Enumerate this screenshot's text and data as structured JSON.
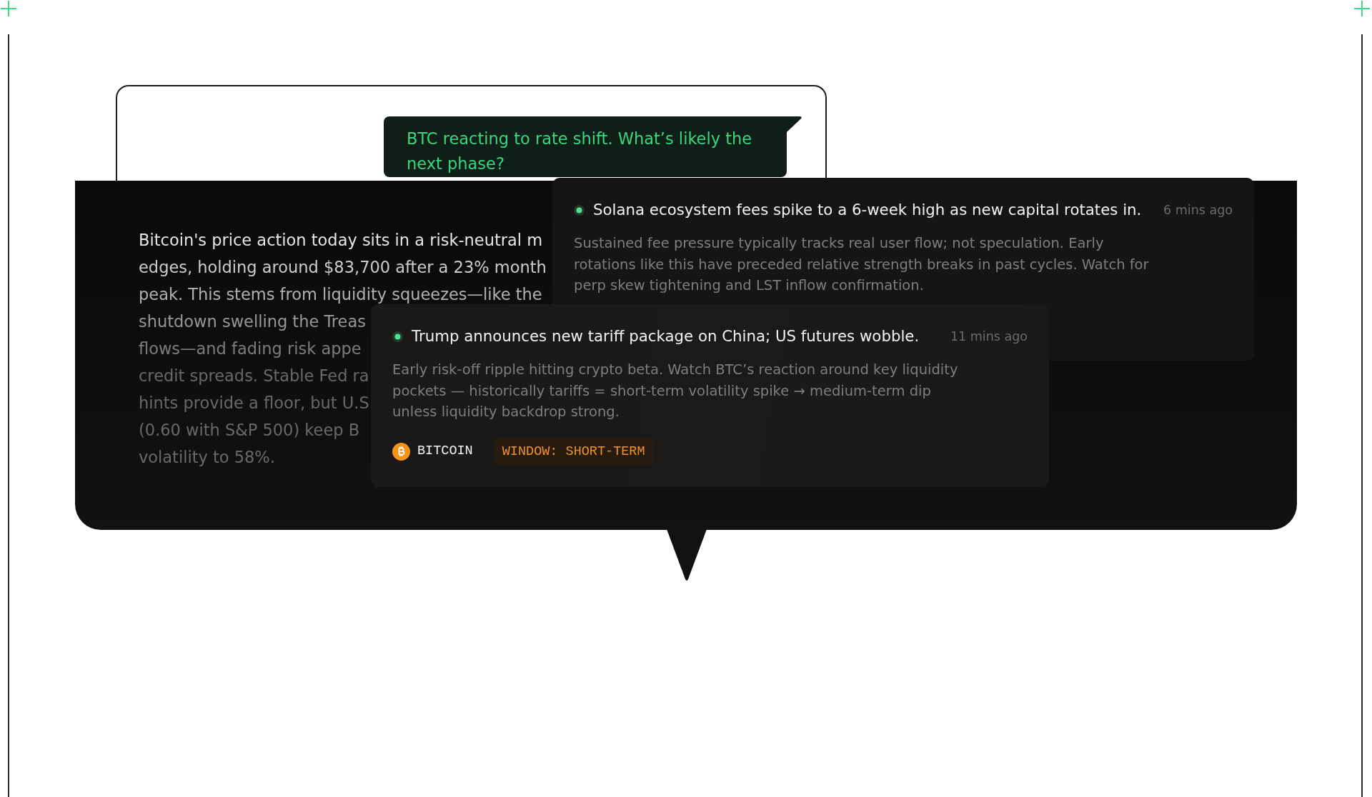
{
  "user_message": {
    "text": "BTC reacting to rate shift. What’s likely the next phase?"
  },
  "response": {
    "lines": [
      "Bitcoin's price action today sits in a risk-neutral m",
      "edges, holding around $83,700 after a 23% month",
      "peak. This stems from liquidity squeezes—like the",
      "shutdown swelling the Treas",
      "flows—and fading risk appe",
      "credit spreads. Stable Fed ra",
      "hints provide a floor, but U.S",
      "(0.60 with S&P 500) keep B",
      "volatility to 58%."
    ]
  },
  "news_cards": [
    {
      "title": "Solana ecosystem fees spike to a 6-week high as new capital rotates in.",
      "time": "6 mins ago",
      "body": "Sustained fee pressure typically tracks real user flow; not speculation. Early rotations like this have preceded relative strength breaks in past cycles. Watch for perp skew tightening and LST inflow confirmation."
    },
    {
      "title": "Trump announces new tariff package on China; US futures wobble.",
      "time": "11 mins ago",
      "body": "Early risk-off ripple hitting crypto beta. Watch BTC’s reaction around key liquidity pockets — historically tariffs = short-term volatility spike → medium-term dip unless liquidity backdrop strong.",
      "tags": [
        {
          "kind": "asset",
          "label": "BITCOIN"
        },
        {
          "kind": "window",
          "label": "WINDOW: SHORT-TERM"
        }
      ]
    }
  ]
}
